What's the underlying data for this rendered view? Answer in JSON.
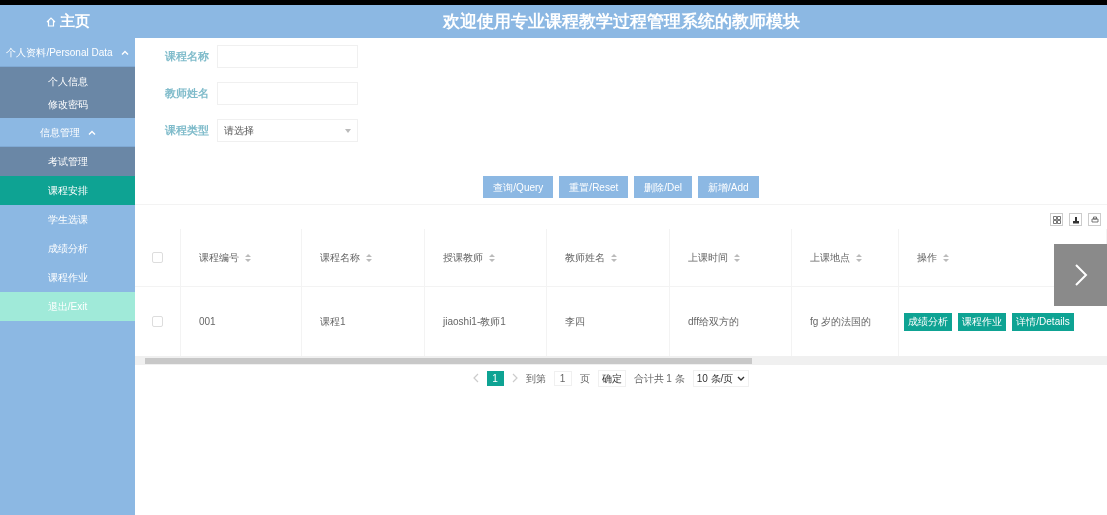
{
  "header": {
    "home": "主页",
    "title": "欢迎使用专业课程教学过程管理系统的教师模块"
  },
  "sidebar": {
    "groups": [
      {
        "label": "个人资料/Personal Data",
        "expanded": true,
        "children": [
          {
            "label": "个人信息",
            "selected": false
          },
          {
            "label": "修改密码",
            "selected": false
          }
        ]
      },
      {
        "label": "信息管理",
        "expanded": true,
        "children": [
          {
            "label": "考试管理",
            "selected": false
          },
          {
            "label": "课程安排",
            "selected": true
          },
          {
            "label": "学生选课",
            "selected": false
          },
          {
            "label": "成绩分析",
            "selected": false
          },
          {
            "label": "课程作业",
            "selected": false
          }
        ]
      }
    ],
    "exit": "退出/Exit"
  },
  "filters": [
    {
      "kind": "text",
      "label": "课程名称"
    },
    {
      "kind": "text",
      "label": "教师姓名"
    },
    {
      "kind": "select",
      "label": "课程类型",
      "placeholder": "请选择"
    }
  ],
  "actions": [
    "查询/Query",
    "重置/Reset",
    "删除/Del",
    "新增/Add"
  ],
  "table": {
    "all_checked": false,
    "columns": [
      "课程编号",
      "课程名称",
      "授课教师",
      "教师姓名",
      "上课时间",
      "上课地点",
      "操作"
    ],
    "rows": [
      {
        "checked": false,
        "cells": [
          "001",
          "课程1",
          "jiaoshi1-教师1",
          "李四",
          "dff给双方的",
          "fg 岁的法国的"
        ],
        "buttons": [
          "成绩分析",
          "课程作业",
          "详情/Details"
        ]
      }
    ]
  },
  "pagination": {
    "pages": [
      {
        "label": "1",
        "selected": true
      }
    ],
    "goto_label": "到第",
    "goto_value": "1",
    "page_unit": "页",
    "confirm": "确定",
    "total": "合计共 1 条",
    "page_size": "10 条/页"
  }
}
